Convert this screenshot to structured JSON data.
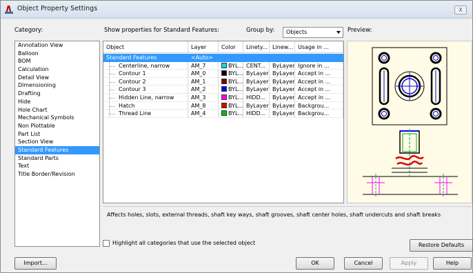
{
  "window": {
    "title": "Object Property Settings",
    "close_glyph": "X"
  },
  "labels": {
    "category": "Category:",
    "show_props": "Show properties for Standard Features:",
    "group_by": "Group by:",
    "preview": "Preview:"
  },
  "group_by_value": "Objects",
  "categories": [
    "Annotation View",
    "Balloon",
    "BOM",
    "Calculation",
    "Detail View",
    "Dimensioning",
    "Drafting",
    "Hide",
    "Hole Chart",
    "Mechanical Symbols",
    "Non Plottable",
    "Part List",
    "Section View",
    "Standard Features",
    "Standard Parts",
    "Text",
    "Title Border/Revision"
  ],
  "selected_category": "Standard Features",
  "grid": {
    "headers": [
      "Object",
      "Layer",
      "Color",
      "Linety...",
      "Linew...",
      "Usage in ..."
    ],
    "rows": [
      {
        "object": "Standard Features",
        "layer": "<Auto>",
        "color": "",
        "swatch": "",
        "linetype": "",
        "lineweight": "",
        "usage": "",
        "selected": true,
        "child": false
      },
      {
        "object": "Centerline, narrow",
        "layer": "AM_7",
        "color": "BYL...",
        "swatch": "#00e0e0",
        "linetype": "CENT...",
        "lineweight": "ByLayer",
        "usage": "Ignore in ...",
        "child": true
      },
      {
        "object": "Contour 1",
        "layer": "AM_0",
        "color": "BYL...",
        "swatch": "#000000",
        "linetype": "ByLayer",
        "lineweight": "ByLayer",
        "usage": "Accept in ...",
        "child": true
      },
      {
        "object": "Contour 2",
        "layer": "AM_1",
        "color": "BYL...",
        "swatch": "#800000",
        "linetype": "ByLayer",
        "lineweight": "ByLayer",
        "usage": "Accept in ...",
        "child": true
      },
      {
        "object": "Contour 3",
        "layer": "AM_2",
        "color": "BYL...",
        "swatch": "#0000ff",
        "linetype": "ByLayer",
        "lineweight": "ByLayer",
        "usage": "Accept in ...",
        "child": true
      },
      {
        "object": "Hidden Line, narrow",
        "layer": "AM_3",
        "color": "BYL...",
        "swatch": "#ff00ff",
        "linetype": "HIDD...",
        "lineweight": "ByLayer",
        "usage": "Accept in ...",
        "child": true
      },
      {
        "object": "Hatch",
        "layer": "AM_8",
        "color": "BYL...",
        "swatch": "#e00000",
        "linetype": "ByLayer",
        "lineweight": "ByLayer",
        "usage": "Backgrou...",
        "child": true
      },
      {
        "object": "Thread Line",
        "layer": "AM_4",
        "color": "BYL...",
        "swatch": "#00c000",
        "linetype": "HIDD...",
        "lineweight": "ByLayer",
        "usage": "Backgrou...",
        "child": true
      }
    ]
  },
  "description": "Affects holes, slots, external threads, shaft key ways, shaft grooves, shaft center holes, shaft undercuts and shaft breaks",
  "highlight_checkbox": {
    "label": "Highlight all categories that use the selected object",
    "checked": false
  },
  "buttons": {
    "restore": "Restore Defaults",
    "import": "Import...",
    "ok": "OK",
    "cancel": "Cancel",
    "apply": "Apply",
    "help": "Help"
  }
}
